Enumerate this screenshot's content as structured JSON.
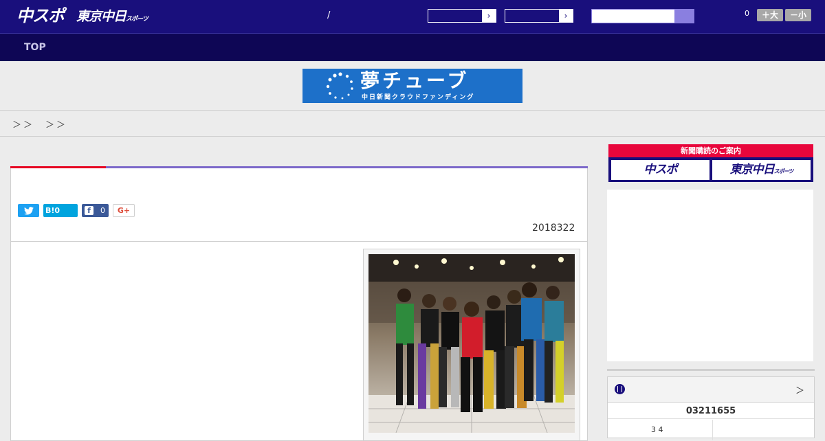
{
  "header": {
    "logo_main": "中スポ",
    "logo_tokyo": "東京中日",
    "logo_tokyo_suffix": "スポーツ",
    "slash": "/",
    "select_arrow": "›",
    "count": "0",
    "font_larger": "＋大",
    "font_smaller": "－小"
  },
  "nav": {
    "items": [
      "TOP"
    ]
  },
  "banner": {
    "title": "夢チューブ",
    "subtitle": "中日新聞クラウドファンディング"
  },
  "breadcrumb": {
    "text": "＞＞　＞＞"
  },
  "article": {
    "date": "2018322",
    "share": {
      "twitter_icon": "twitter-icon",
      "hatena_label": "B!0",
      "facebook_icon": "f",
      "facebook_count": "0",
      "gplus_label": "G+"
    }
  },
  "sidebar": {
    "subscribe_title": "新聞購読のご案内",
    "sub_chuspo": "中スポ",
    "sub_tokyo": "東京中日",
    "sub_tokyo_suffix": "スポーツ",
    "score_arrow": "＞",
    "score_title": "03211655",
    "score_mini": "3  4"
  },
  "colors": {
    "header_bg": "#190f7c",
    "nav_bg": "#0e0655",
    "accent_red": "#e60020",
    "accent_purple": "#7c68c9",
    "banner_blue": "#1d70c9"
  }
}
